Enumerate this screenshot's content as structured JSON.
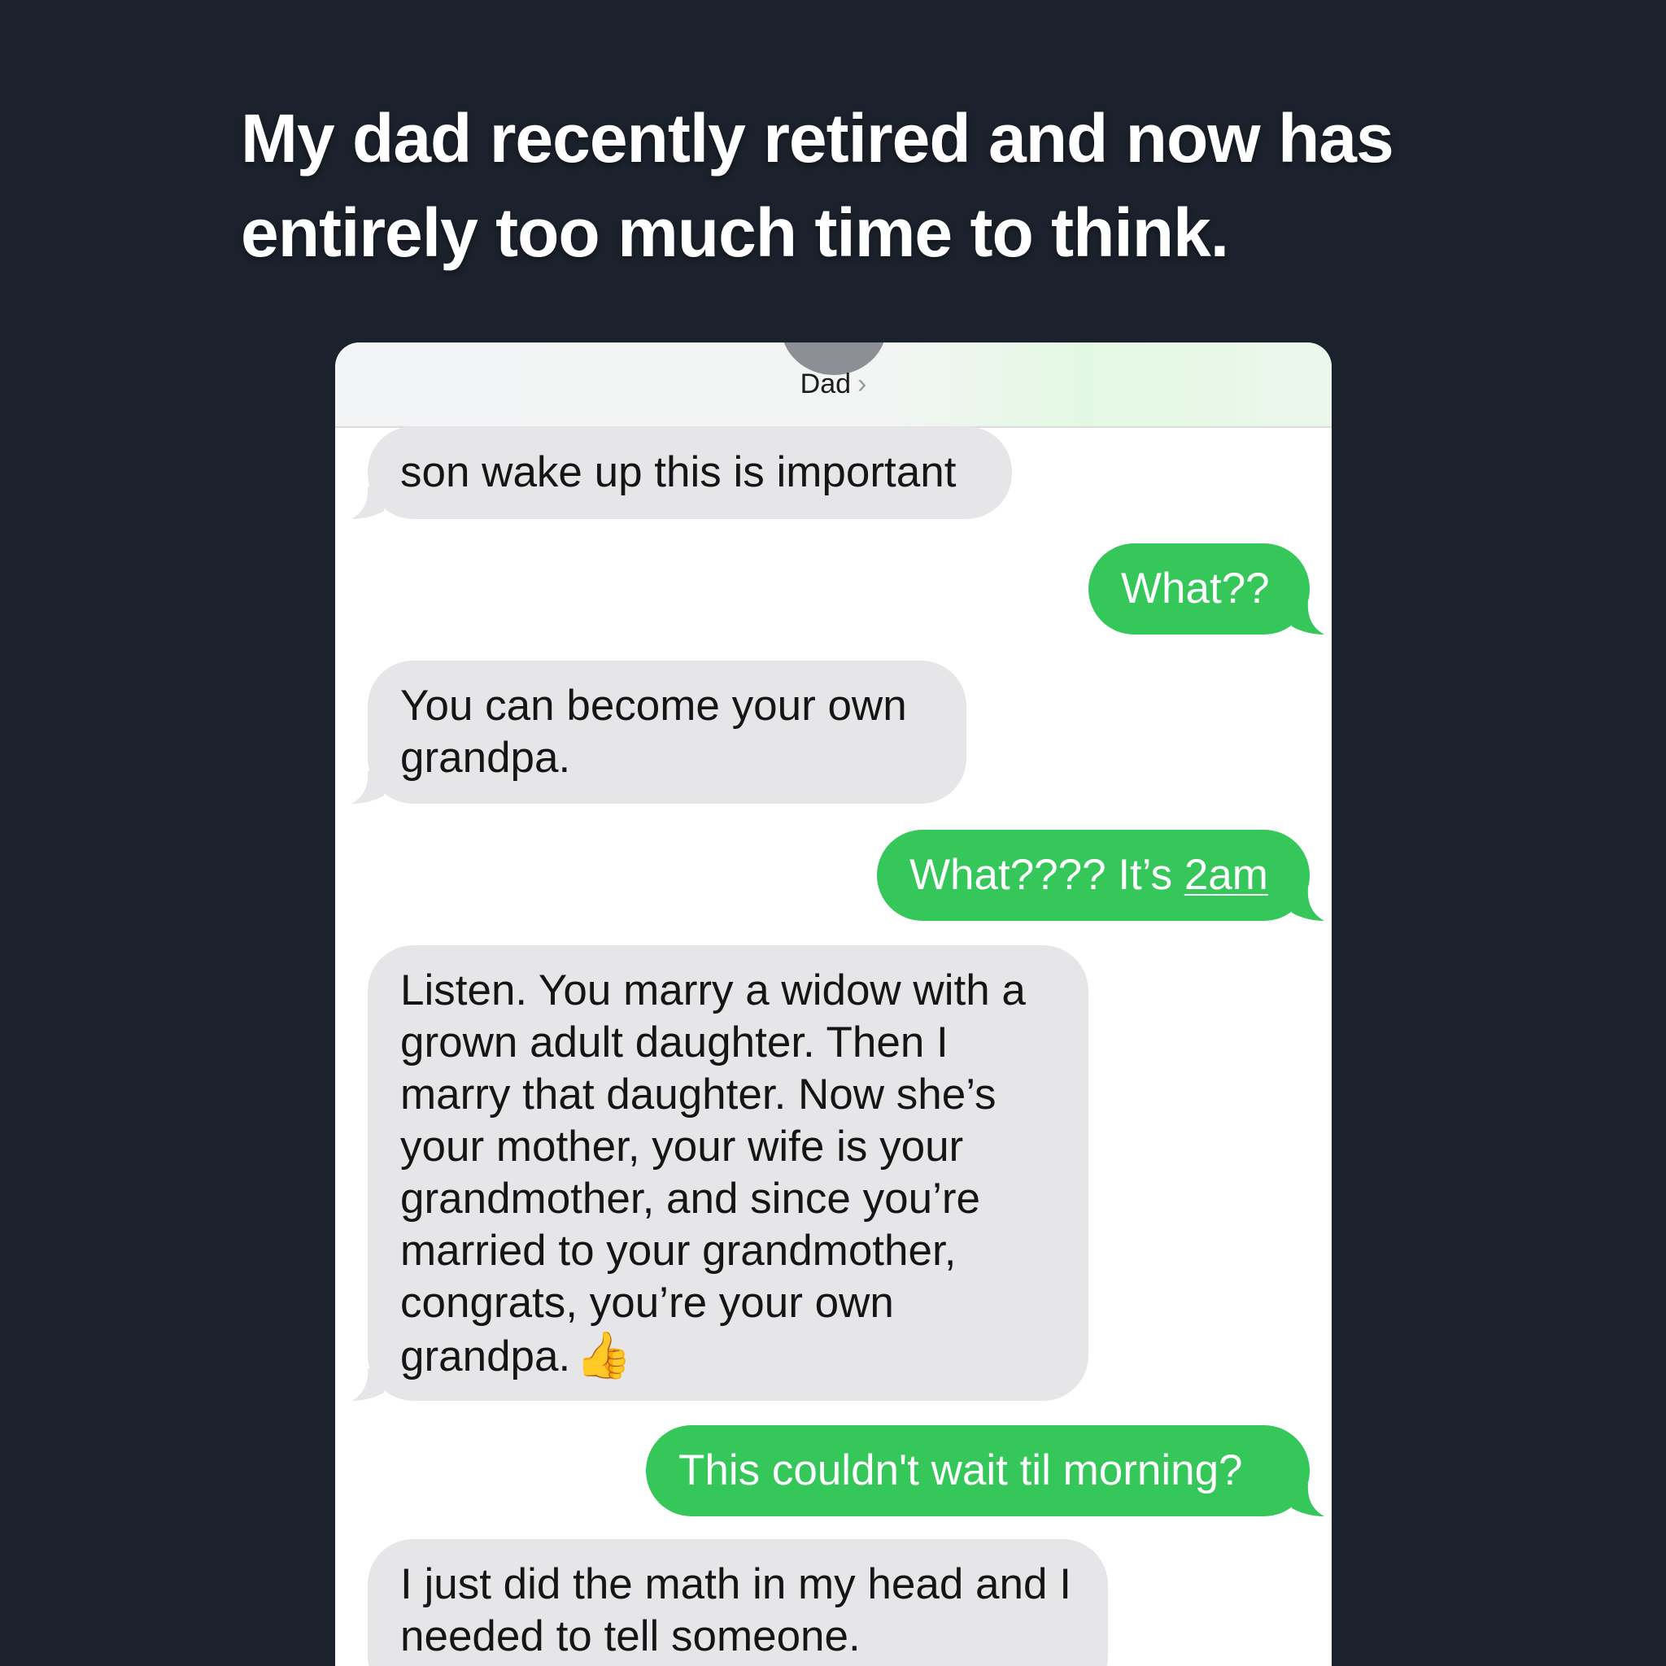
{
  "caption": "My dad recently retired and now has entirely too much time to think.",
  "header": {
    "contact_name": "Dad",
    "chevron": "›"
  },
  "messages": [
    {
      "side": "in",
      "text": "son wake up this is important"
    },
    {
      "side": "out",
      "text": "What??"
    },
    {
      "side": "in",
      "text": "You can become your own grandpa."
    },
    {
      "side": "out",
      "text_prefix": "What???? It’s ",
      "text_link": "2am"
    },
    {
      "side": "in",
      "text": "Listen. You marry a widow with a grown adult daughter. Then I marry that daughter. Now she’s your mother, your wife is your grandmother, and since you’re married to your grandmother, congrats, you’re your own grandpa.",
      "emoji": "👍"
    },
    {
      "side": "out",
      "text": "This couldn't wait til morning?"
    },
    {
      "side": "in",
      "text": "I just did the math in my head and I needed to tell someone."
    }
  ],
  "colors": {
    "background": "#1c222d",
    "incoming_bubble": "#e6e6e9",
    "outgoing_bubble": "#35c759"
  }
}
